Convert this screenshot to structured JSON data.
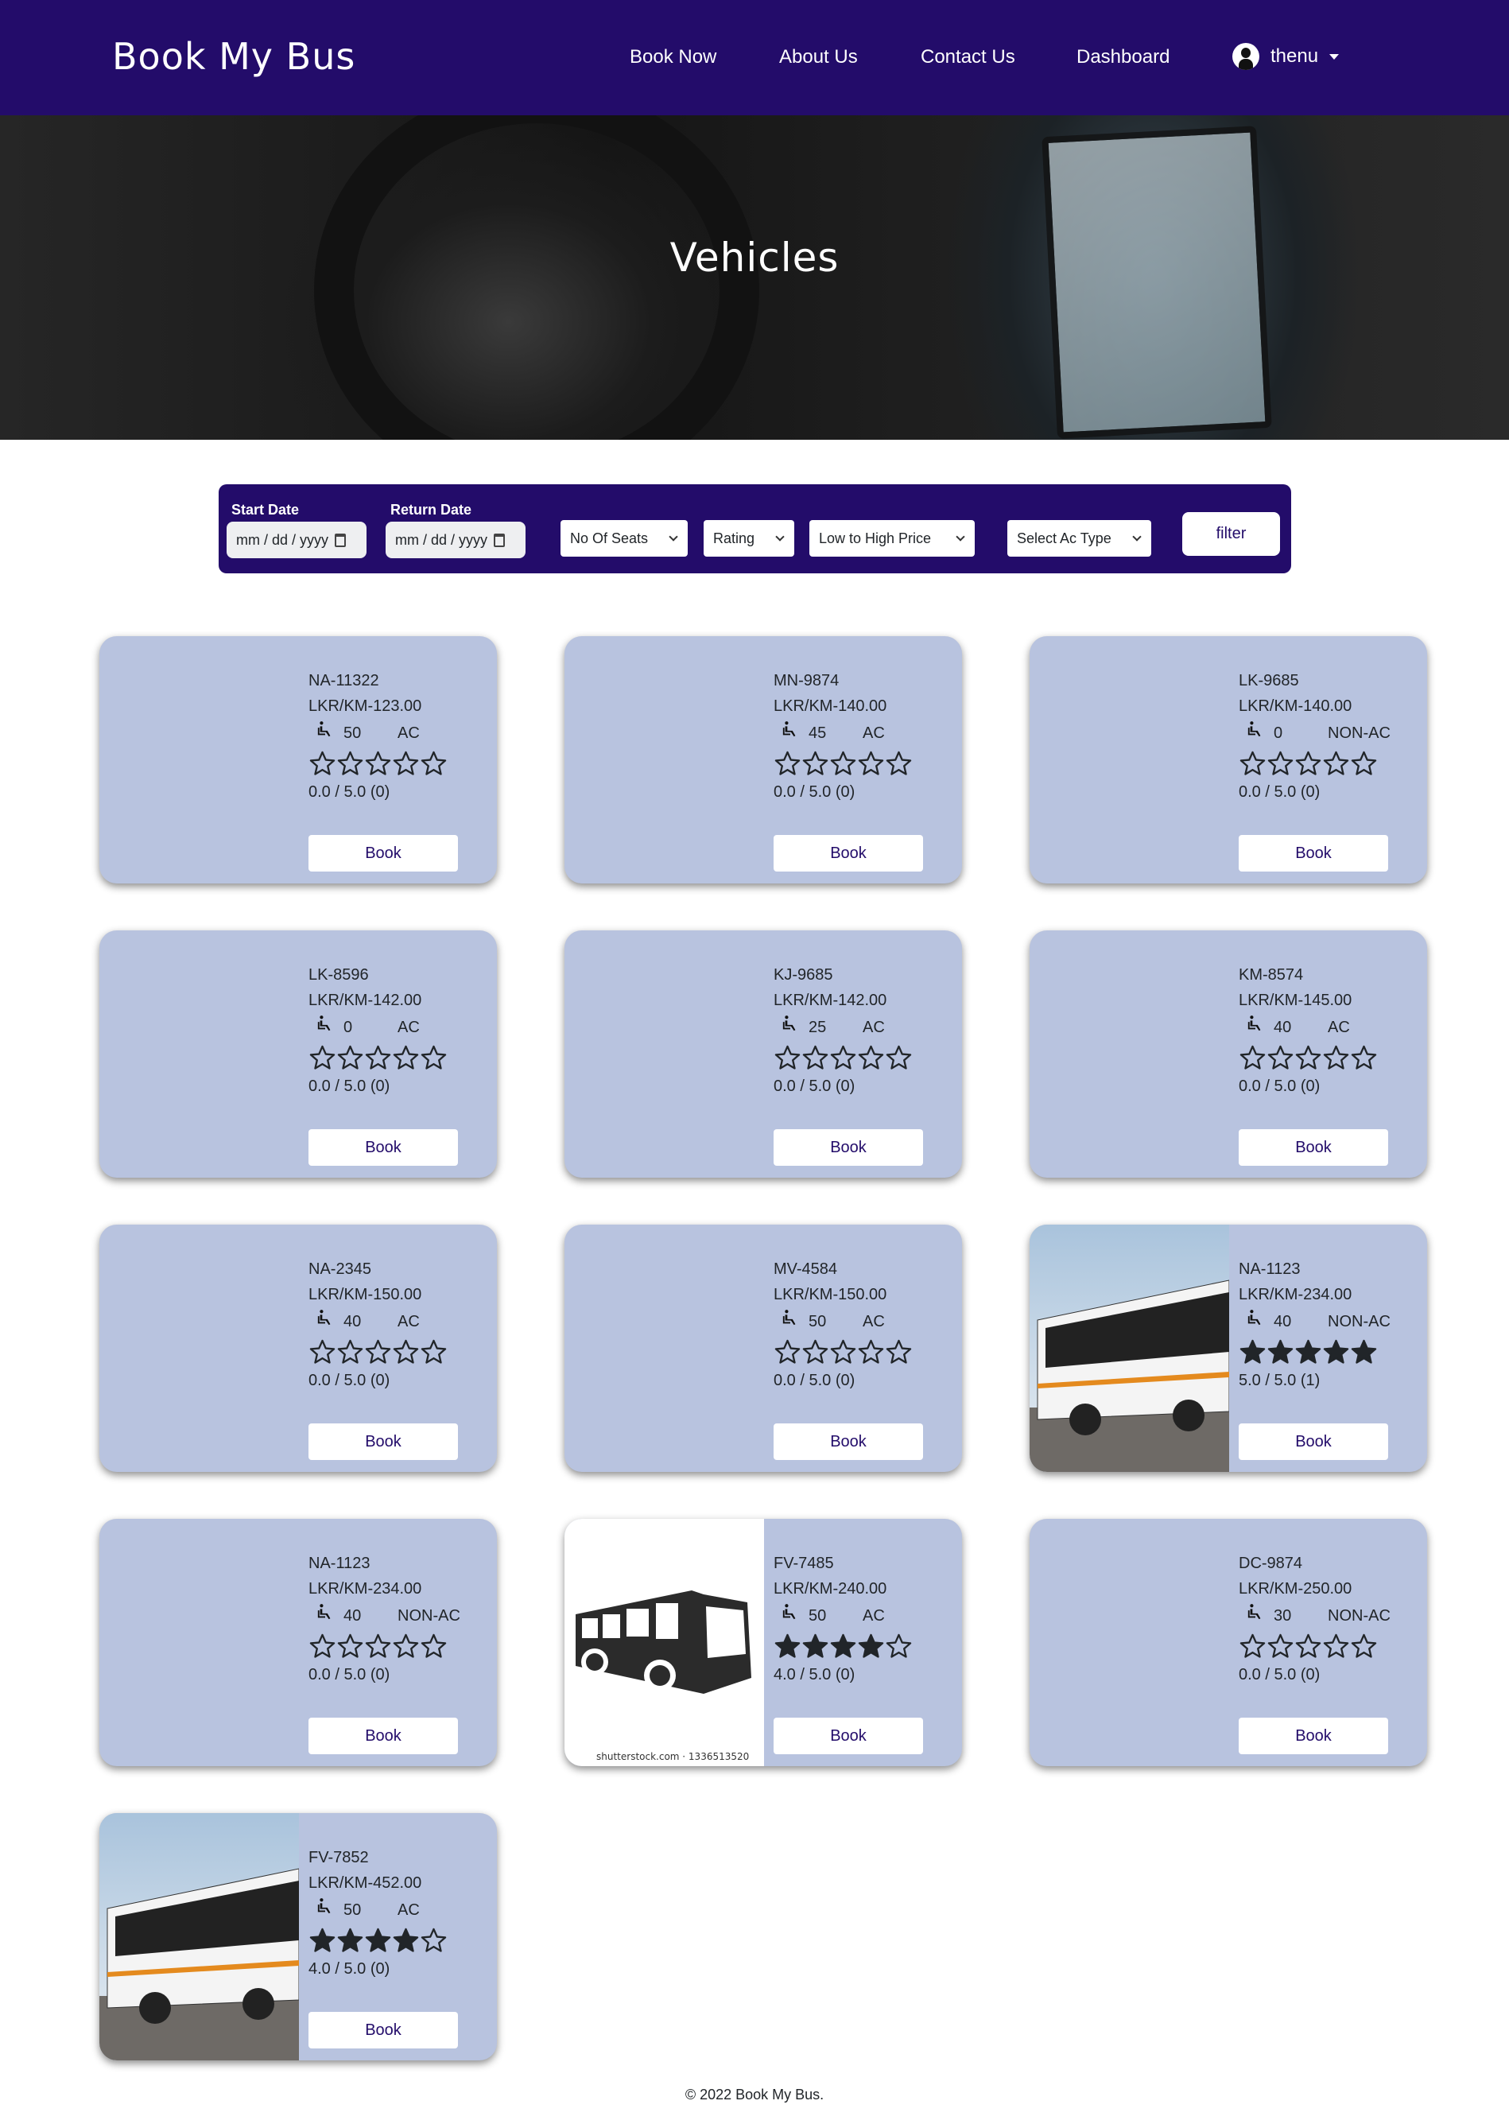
{
  "header": {
    "brand": "Book My Bus",
    "nav": [
      "Book Now",
      "About Us",
      "Contact Us",
      "Dashboard"
    ],
    "user": "thenu",
    "color": "#230c6a"
  },
  "hero": {
    "title": "Vehicles"
  },
  "filter": {
    "start_label": "Start Date",
    "start_placeholder": "mm / dd / yyyy",
    "return_label": "Return Date",
    "return_placeholder": "mm / dd / yyyy",
    "seats": "No Of Seats",
    "rating": "Rating",
    "price": "Low to High Price",
    "ac": "Select Ac Type",
    "button": "filter"
  },
  "vehicles": [
    {
      "number": "NA-11322",
      "price": "LKR/KM-123.00",
      "seats": "50",
      "ac": "AC",
      "stars": 0,
      "rating": "0.0 / 5.0 (0)",
      "image": "none",
      "book": "Book"
    },
    {
      "number": "MN-9874",
      "price": "LKR/KM-140.00",
      "seats": "45",
      "ac": "AC",
      "stars": 0,
      "rating": "0.0 / 5.0 (0)",
      "image": "none",
      "book": "Book"
    },
    {
      "number": "LK-9685",
      "price": "LKR/KM-140.00",
      "seats": "0",
      "ac": "NON-AC",
      "stars": 0,
      "rating": "0.0 / 5.0 (0)",
      "image": "none",
      "book": "Book"
    },
    {
      "number": "LK-8596",
      "price": "LKR/KM-142.00",
      "seats": "0",
      "ac": "AC",
      "stars": 0,
      "rating": "0.0 / 5.0 (0)",
      "image": "none",
      "book": "Book"
    },
    {
      "number": "KJ-9685",
      "price": "LKR/KM-142.00",
      "seats": "25",
      "ac": "AC",
      "stars": 0,
      "rating": "0.0 / 5.0 (0)",
      "image": "none",
      "book": "Book"
    },
    {
      "number": "KM-8574",
      "price": "LKR/KM-145.00",
      "seats": "40",
      "ac": "AC",
      "stars": 0,
      "rating": "0.0 / 5.0 (0)",
      "image": "none",
      "book": "Book"
    },
    {
      "number": "NA-2345",
      "price": "LKR/KM-150.00",
      "seats": "40",
      "ac": "AC",
      "stars": 0,
      "rating": "0.0 / 5.0 (0)",
      "image": "none",
      "book": "Book"
    },
    {
      "number": "MV-4584",
      "price": "LKR/KM-150.00",
      "seats": "50",
      "ac": "AC",
      "stars": 0,
      "rating": "0.0 / 5.0 (0)",
      "image": "none",
      "book": "Book"
    },
    {
      "number": "NA-1123",
      "price": "LKR/KM-234.00",
      "seats": "40",
      "ac": "NON-AC",
      "stars": 5,
      "rating": "5.0 / 5.0 (1)",
      "image": "bus-photo",
      "book": "Book"
    },
    {
      "number": "NA-1123",
      "price": "LKR/KM-234.00",
      "seats": "40",
      "ac": "NON-AC",
      "stars": 0,
      "rating": "0.0 / 5.0 (0)",
      "image": "none",
      "book": "Book"
    },
    {
      "number": "FV-7485",
      "price": "LKR/KM-240.00",
      "seats": "50",
      "ac": "AC",
      "stars": 4,
      "rating": "4.0 / 5.0 (0)",
      "image": "bus-icon",
      "image_caption": "shutterstock.com · 1336513520",
      "book": "Book"
    },
    {
      "number": "DC-9874",
      "price": "LKR/KM-250.00",
      "seats": "30",
      "ac": "NON-AC",
      "stars": 0,
      "rating": "0.0 / 5.0 (0)",
      "image": "none",
      "book": "Book"
    },
    {
      "number": "FV-7852",
      "price": "LKR/KM-452.00",
      "seats": "50",
      "ac": "AC",
      "stars": 4,
      "rating": "4.0 / 5.0 (0)",
      "image": "bus-photo",
      "book": "Book"
    }
  ],
  "footer": {
    "text": "© 2022 Book My Bus."
  }
}
